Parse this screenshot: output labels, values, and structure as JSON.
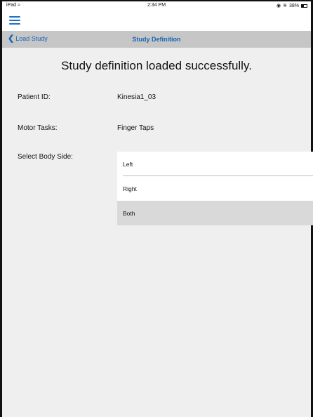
{
  "status_bar": {
    "device": "iPad",
    "time": "2:34 PM",
    "battery": "38%"
  },
  "nav": {
    "back_label": "Load Study",
    "title": "Study Definition"
  },
  "main": {
    "headline": "Study definition loaded successfully.",
    "patient_id_label": "Patient ID:",
    "patient_id_value": "Kinesia1_03",
    "motor_tasks_label": "Motor Tasks:",
    "motor_tasks_value": "Finger Taps",
    "body_side_label": "Select Body Side:",
    "body_side_options": [
      "Left",
      "Right",
      "Both"
    ],
    "body_side_selected": "Both"
  },
  "colors": {
    "accent": "#1763b6",
    "nav_background": "#c6c6c6",
    "content_background": "#efefef"
  },
  "icons": [
    "wifi-icon",
    "location-icon",
    "bluetooth-icon",
    "battery-icon",
    "hamburger-icon",
    "chevron-left-icon"
  ]
}
